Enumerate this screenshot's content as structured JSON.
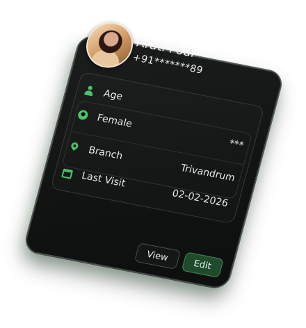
{
  "profile": {
    "name": "Arati Podi",
    "phone": "+91*******89"
  },
  "details": [
    {
      "label": "Age",
      "value": "",
      "icon": "person-icon"
    },
    {
      "label": "Female",
      "value": "***",
      "icon": "gender-icon"
    },
    {
      "label": "Branch",
      "value": "Trivandrum",
      "icon": "location-pin-icon"
    },
    {
      "label": "Last Visit",
      "value": "02-02-2026",
      "icon": "calendar-icon"
    }
  ],
  "actions": {
    "view_label": "View",
    "edit_label": "Edit"
  },
  "colors": {
    "accent": "#4cc36a",
    "card_bg": "#121413",
    "edit_button_bg": "#1f4a2c"
  }
}
